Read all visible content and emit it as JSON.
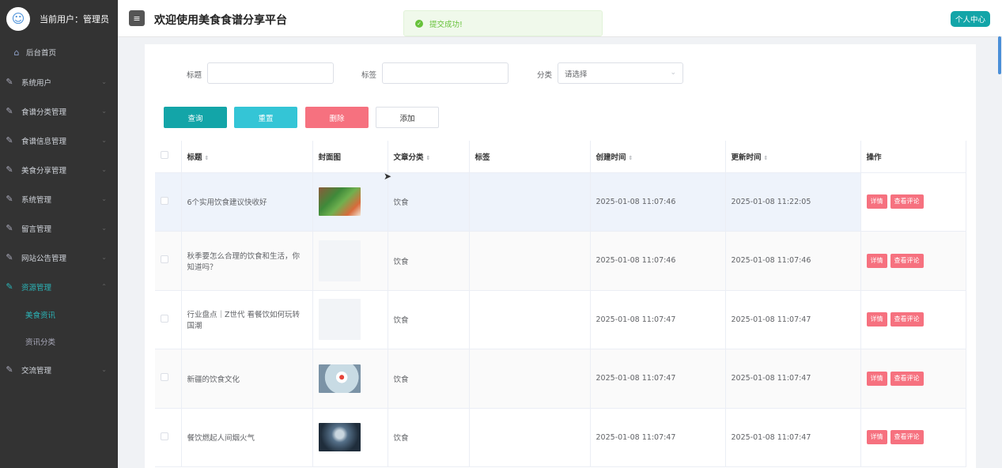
{
  "sidebar": {
    "user_label": "当前用户：管理员",
    "home": "后台首页",
    "items": [
      {
        "label": "系统用户"
      },
      {
        "label": "食谱分类管理"
      },
      {
        "label": "食谱信息管理"
      },
      {
        "label": "美食分享管理"
      },
      {
        "label": "系统管理"
      },
      {
        "label": "留言管理"
      },
      {
        "label": "网站公告管理"
      },
      {
        "label": "资源管理"
      }
    ],
    "sub_items": [
      {
        "label": "美食资讯"
      },
      {
        "label": "资讯分类"
      }
    ],
    "last_item": "交流管理"
  },
  "header": {
    "title": "欢迎使用美食食谱分享平台",
    "toast": "提交成功!",
    "profile": "个人中心"
  },
  "filter": {
    "title_label": "标题",
    "tag_label": "标签",
    "category_label": "分类",
    "category_value": "请选择"
  },
  "buttons": {
    "search": "查询",
    "reset": "重置",
    "delete": "删除",
    "add": "添加"
  },
  "table": {
    "columns": [
      "标题",
      "封面图",
      "文章分类",
      "标签",
      "创建时间",
      "更新时间",
      "操作"
    ],
    "rows": [
      {
        "title": "6个实用饮食建议快收好",
        "category": "饮食",
        "tag": "",
        "created": "2025-01-08 11:07:46",
        "updated": "2025-01-08 11:22:05"
      },
      {
        "title": "秋季要怎么合理的饮食和生活，你知道吗？",
        "category": "饮食",
        "tag": "",
        "created": "2025-01-08 11:07:46",
        "updated": "2025-01-08 11:07:46"
      },
      {
        "title": "行业盘点｜Z世代 看餐饮如何玩转国潮",
        "category": "饮食",
        "tag": "",
        "created": "2025-01-08 11:07:47",
        "updated": "2025-01-08 11:07:47"
      },
      {
        "title": "新疆的饮食文化",
        "category": "饮食",
        "tag": "",
        "created": "2025-01-08 11:07:47",
        "updated": "2025-01-08 11:07:47"
      },
      {
        "title": "餐饮燃起人间烟火气",
        "category": "饮食",
        "tag": "",
        "created": "2025-01-08 11:07:47",
        "updated": "2025-01-08 11:07:47"
      }
    ],
    "op_detail": "详情",
    "op_comments": "查看评论"
  },
  "colors": {
    "accent": "#13a5a8",
    "danger": "#f6717f",
    "sidebar_bg": "#333333"
  }
}
